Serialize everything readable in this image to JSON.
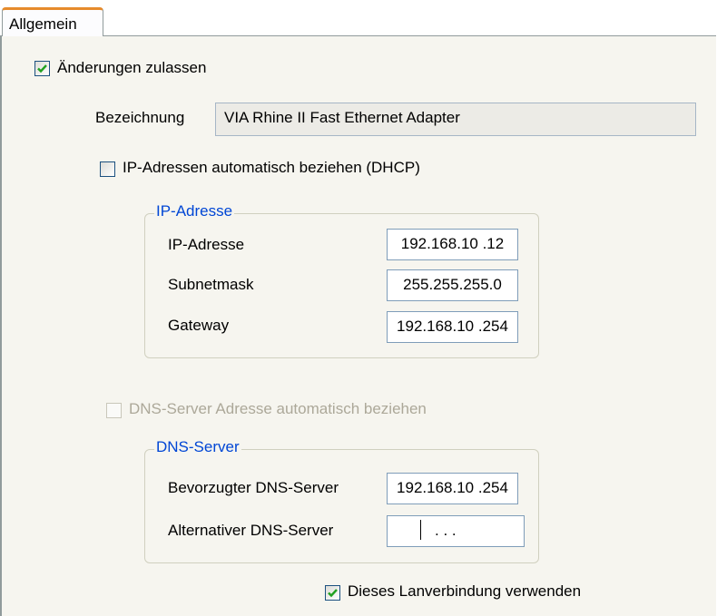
{
  "tab": {
    "label": "Allgemein"
  },
  "allow_changes": {
    "label": "Änderungen zulassen",
    "checked": true
  },
  "designation": {
    "label": "Bezeichnung",
    "value": "VIA Rhine II Fast Ethernet Adapter"
  },
  "dhcp": {
    "label": "IP-Adressen automatisch beziehen (DHCP)",
    "checked": false
  },
  "ip_group": {
    "legend": "IP-Adresse",
    "ip_label": "IP-Adresse",
    "ip_value": "192.168.10 .12",
    "subnet_label": "Subnetmask",
    "subnet_value": "255.255.255.0",
    "gateway_label": "Gateway",
    "gateway_value": "192.168.10 .254"
  },
  "dns_auto": {
    "label": "DNS-Server Adresse automatisch beziehen",
    "checked": false,
    "enabled": false
  },
  "dns_group": {
    "legend": "DNS-Server",
    "preferred_label": "Bevorzugter DNS-Server",
    "preferred_value": "192.168.10 .254",
    "alternate_label": "Alternativer DNS-Server",
    "alternate_value": ".   .   ."
  },
  "use_connection": {
    "label": "Dieses Lanverbindung verwenden",
    "checked": true
  },
  "colors": {
    "legend": "#0046d5",
    "panel": "#f6f5ef",
    "tab_accent": "#e68b2c",
    "check": "#21a121",
    "disabled_text": "#aca899"
  }
}
